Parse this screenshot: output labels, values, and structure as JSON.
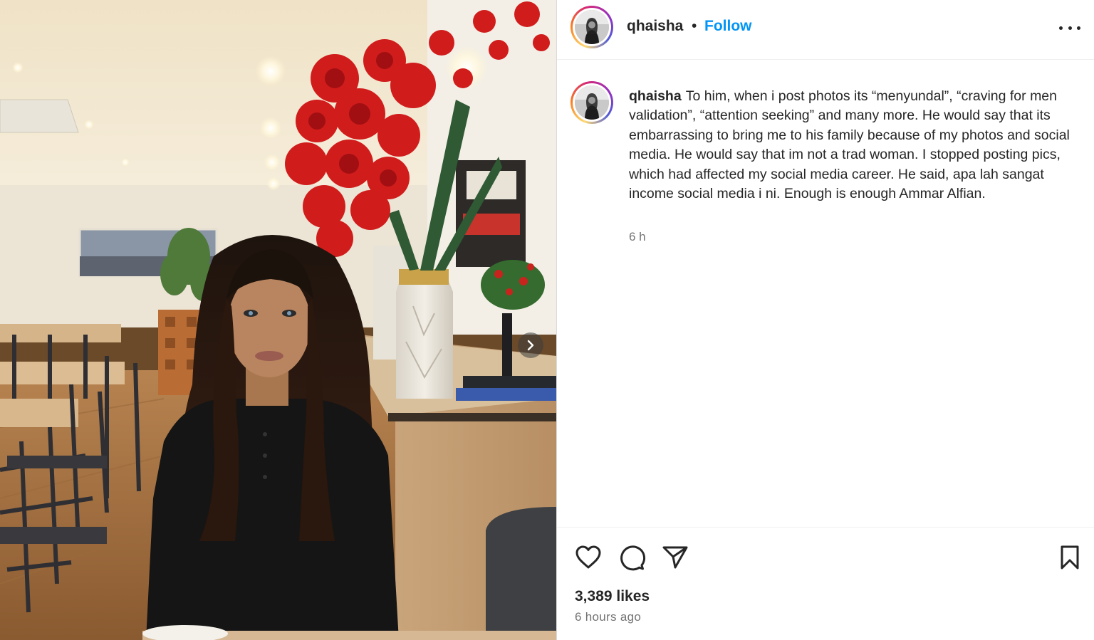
{
  "post": {
    "username": "qhaisha",
    "separator": "•",
    "follow_label": "Follow",
    "more_icon": "more-options-icon",
    "next_icon": "chevron-right-icon"
  },
  "caption": {
    "username": "qhaisha",
    "text": "To him, when i post photos its “menyundal”, “craving for men validation”, “attention seeking” and many more. He would say that its embarrassing to bring me to his family because of my photos and social media. He would say that im not a trad woman. I stopped posting pics, which had affected my social media career. He said, apa lah sangat income social media i ni. Enough is enough Ammar Alfian.",
    "time": "6 h"
  },
  "actions": {
    "icons": [
      "heart-icon",
      "comment-icon",
      "share-icon",
      "bookmark-icon"
    ],
    "likes": "3,389 likes",
    "date": "6 hours ago"
  },
  "colors": {
    "link_blue": "#0095f6",
    "text_primary": "#262626",
    "text_secondary": "#737373",
    "border": "#efefef"
  }
}
